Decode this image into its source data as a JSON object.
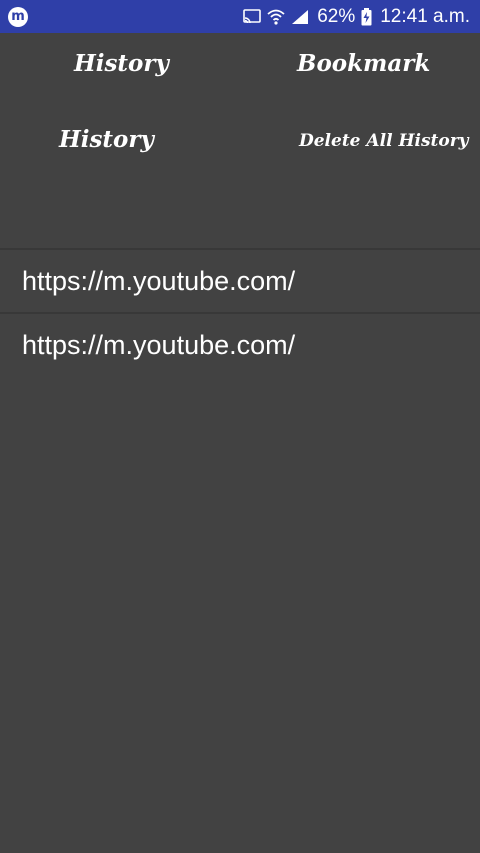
{
  "status_bar": {
    "app_icon": "m",
    "battery_percent": "62%",
    "time": "12:41 a.m.",
    "icons": [
      "cast-icon",
      "wifi-icon",
      "signal-icon",
      "battery-charging-icon"
    ],
    "bg_color": "#2f3fa8"
  },
  "tabs": {
    "history_label": "History",
    "bookmark_label": "Bookmark"
  },
  "section": {
    "title": "History",
    "delete_all_label": "Delete All History"
  },
  "history": [
    {
      "url": "https://m.youtube.com/"
    },
    {
      "url": "https://m.youtube.com/"
    }
  ],
  "colors": {
    "background": "#424242",
    "divider": "#383838",
    "text": "#ffffff"
  }
}
